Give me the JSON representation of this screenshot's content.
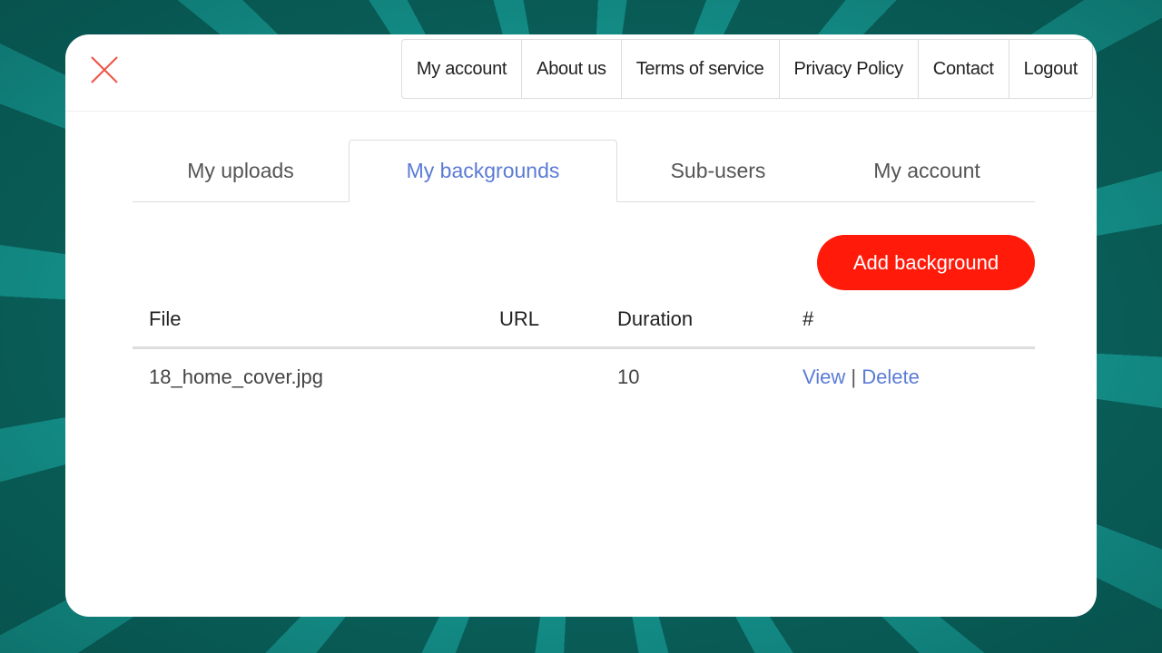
{
  "colors": {
    "accent_red": "#ff1a0a",
    "link_blue": "#5b7bd5",
    "background_teal": "#0c6e68",
    "ray_teal": "#1bb5ae"
  },
  "header": {
    "close_icon": "close-x-icon",
    "nav": [
      {
        "label": "My account"
      },
      {
        "label": "About us"
      },
      {
        "label": "Terms of service"
      },
      {
        "label": "Privacy Policy"
      },
      {
        "label": "Contact"
      },
      {
        "label": "Logout"
      }
    ]
  },
  "tabs": [
    {
      "label": "My uploads",
      "active": false
    },
    {
      "label": "My backgrounds",
      "active": true
    },
    {
      "label": "Sub-users",
      "active": false
    },
    {
      "label": "My account",
      "active": false
    }
  ],
  "actions": {
    "add_background_label": "Add background"
  },
  "table": {
    "columns": [
      "File",
      "URL",
      "Duration",
      "#"
    ],
    "rows": [
      {
        "file": "18_home_cover.jpg",
        "url": "",
        "duration": "10",
        "actions": {
          "view": "View",
          "separator": "|",
          "delete": "Delete"
        }
      }
    ]
  }
}
